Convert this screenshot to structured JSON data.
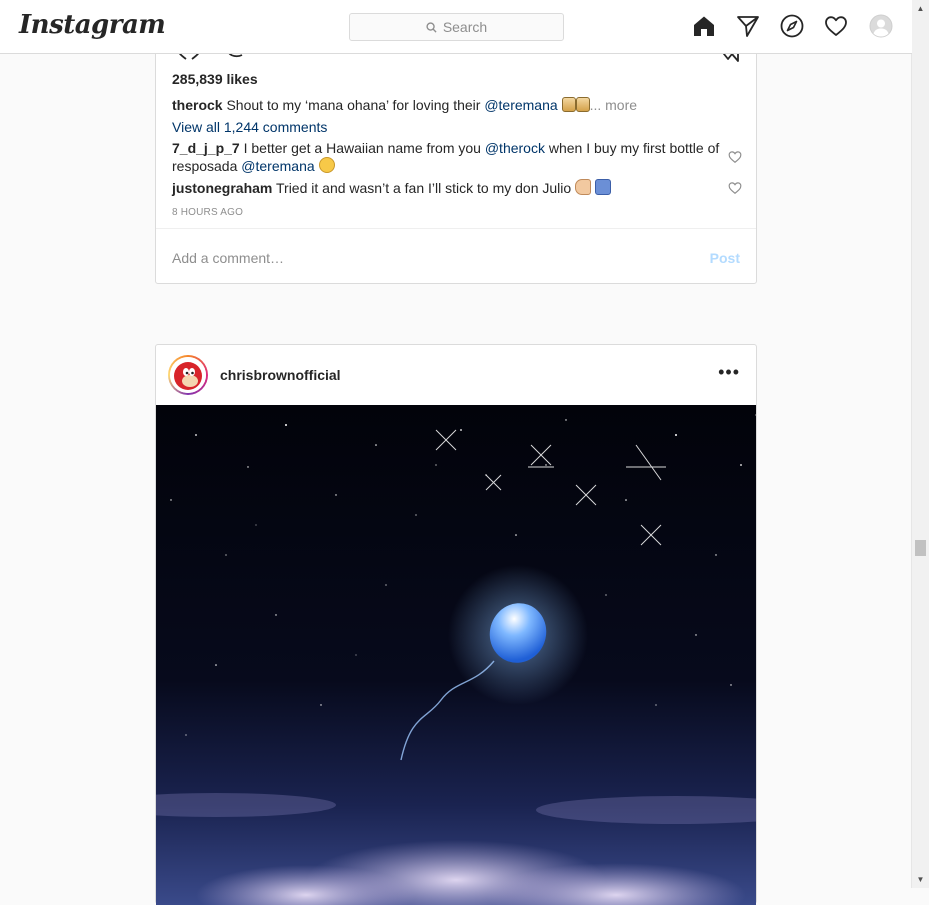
{
  "nav": {
    "logo": "Instagram",
    "search_placeholder": "Search",
    "icons": [
      "home-icon",
      "direct-icon",
      "explore-icon",
      "activity-heart-icon",
      "profile-avatar-icon"
    ]
  },
  "post1": {
    "likes": "285,839 likes",
    "caption_user": "therock",
    "caption_text": " Shout to my ‘mana ohana’ for loving their ",
    "caption_mention": "@teremana",
    "caption_more": "... more",
    "view_all": "View all 1,244 comments",
    "comments": [
      {
        "user": "7_d_j_p_7",
        "text1": " I better get a Hawaiian name from you ",
        "mention1": "@therock",
        "text2": " when I buy my first bottle of resposada ",
        "mention2": "@teremana"
      },
      {
        "user": "justonegraham",
        "text1": " Tried it and wasn’t a fan I’ll stick to my don Julio "
      }
    ],
    "timestamp": "8 HOURS AGO",
    "add_comment_placeholder": "Add a comment…",
    "post_button": "Post"
  },
  "post2": {
    "username": "chrisbrownofficial",
    "more_menu": "•••"
  },
  "colors": {
    "link": "#003569",
    "muted": "#8e8e8e",
    "border": "#dbdbdb",
    "post_disabled": "#b3dbff"
  }
}
